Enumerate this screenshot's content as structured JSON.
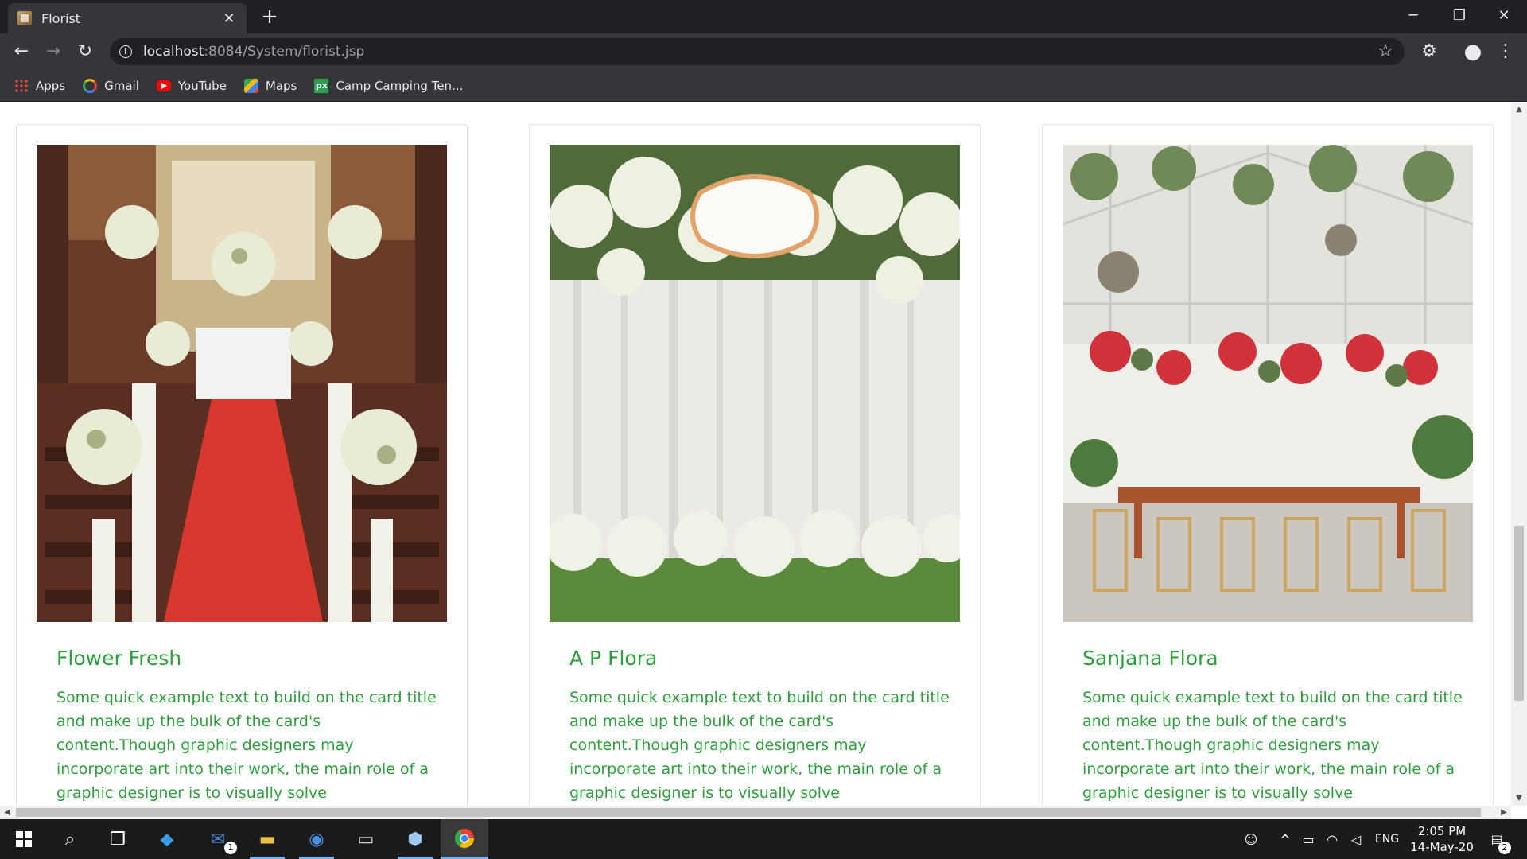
{
  "browser": {
    "tab_title": "Florist",
    "tab_close": "✕",
    "new_tab": "+",
    "url_host": "localhost",
    "url_rest": ":8084/System/florist.jsp",
    "window_controls": [
      "─",
      "❐",
      "✕"
    ],
    "bookmarks": [
      {
        "label": "Apps",
        "icon": "apps-icon"
      },
      {
        "label": "Gmail",
        "icon": "gmail-icon"
      },
      {
        "label": "YouTube",
        "icon": "youtube-icon"
      },
      {
        "label": "Maps",
        "icon": "maps-icon"
      },
      {
        "label": "Camp Camping Ten...",
        "icon": "px-icon",
        "icon_text": "px"
      }
    ]
  },
  "cards": [
    {
      "title": "Flower Fresh",
      "text": "Some quick example text to build on the card title and make up the bulk of the card's content.Though graphic designers may incorporate art into their work, the main role of a graphic designer is to visually solve communication problems using design",
      "image": "church-aisle-flower-decoration"
    },
    {
      "title": "A P Flora",
      "text": "Some quick example text to build on the card title and make up the bulk of the card's content.Though graphic designers may incorporate art into their work, the main role of a graphic designer is to visually solve communication problems using design",
      "image": "white-drape-floral-backdrop"
    },
    {
      "title": "Sanjana Flora",
      "text": "Some quick example text to build on the card title and make up the bulk of the card's content.Though graphic designers may incorporate art into their work, the main role of a graphic designer is to visually solve communication problems using design",
      "image": "greenhouse-table-floral-setup"
    }
  ],
  "taskbar": {
    "clock_time": "2:05 PM",
    "clock_date": "14-May-20",
    "language": "ENG",
    "mail_badge": "1",
    "notification_badge": "2"
  },
  "colors": {
    "accent_green": "#2e9e3c",
    "chrome_dark": "#202124",
    "chrome_mid": "#35363a"
  }
}
